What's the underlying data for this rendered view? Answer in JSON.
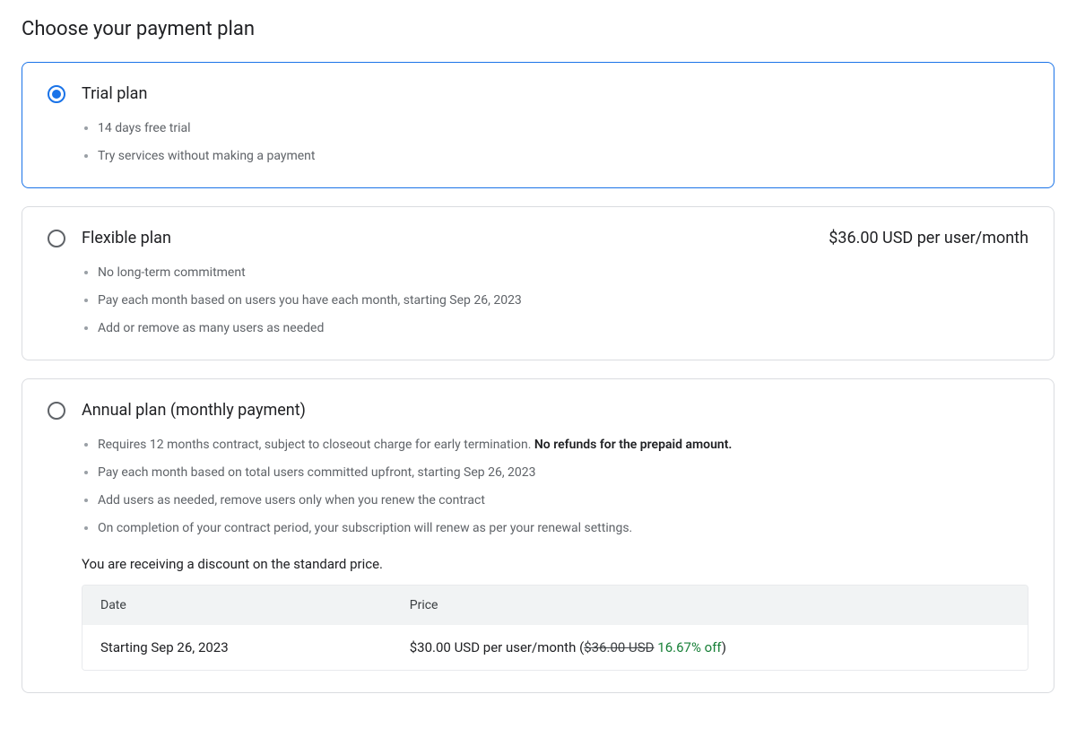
{
  "title": "Choose your payment plan",
  "plans": {
    "trial": {
      "label": "Trial plan",
      "bullets": [
        "14 days free trial",
        "Try services without making a payment"
      ]
    },
    "flexible": {
      "label": "Flexible plan",
      "price": "$36.00 USD per user/month",
      "bullets": [
        "No long-term commitment",
        "Pay each month based on users you have each month, starting Sep 26, 2023",
        "Add or remove as many users as needed"
      ]
    },
    "annual": {
      "label": "Annual plan (monthly payment)",
      "bullet1_a": "Requires 12 months contract, subject to closeout charge for early termination. ",
      "bullet1_b": "No refunds for the prepaid amount.",
      "bullet2": "Pay each month based on total users committed upfront, starting Sep 26, 2023",
      "bullet3": "Add users as needed, remove users only when you renew the contract",
      "bullet4": "On completion of your contract period, your subscription will renew as per your renewal settings.",
      "discount_note": "You are receiving a discount on the standard price.",
      "table": {
        "header_date": "Date",
        "header_price": "Price",
        "row_date": "Starting Sep 26, 2023",
        "row_price_a": "$30.00 USD per user/month (",
        "row_price_strike": "$36.00 USD",
        "row_price_space": " ",
        "row_price_off": "16.67% off",
        "row_price_close": ")"
      }
    }
  }
}
